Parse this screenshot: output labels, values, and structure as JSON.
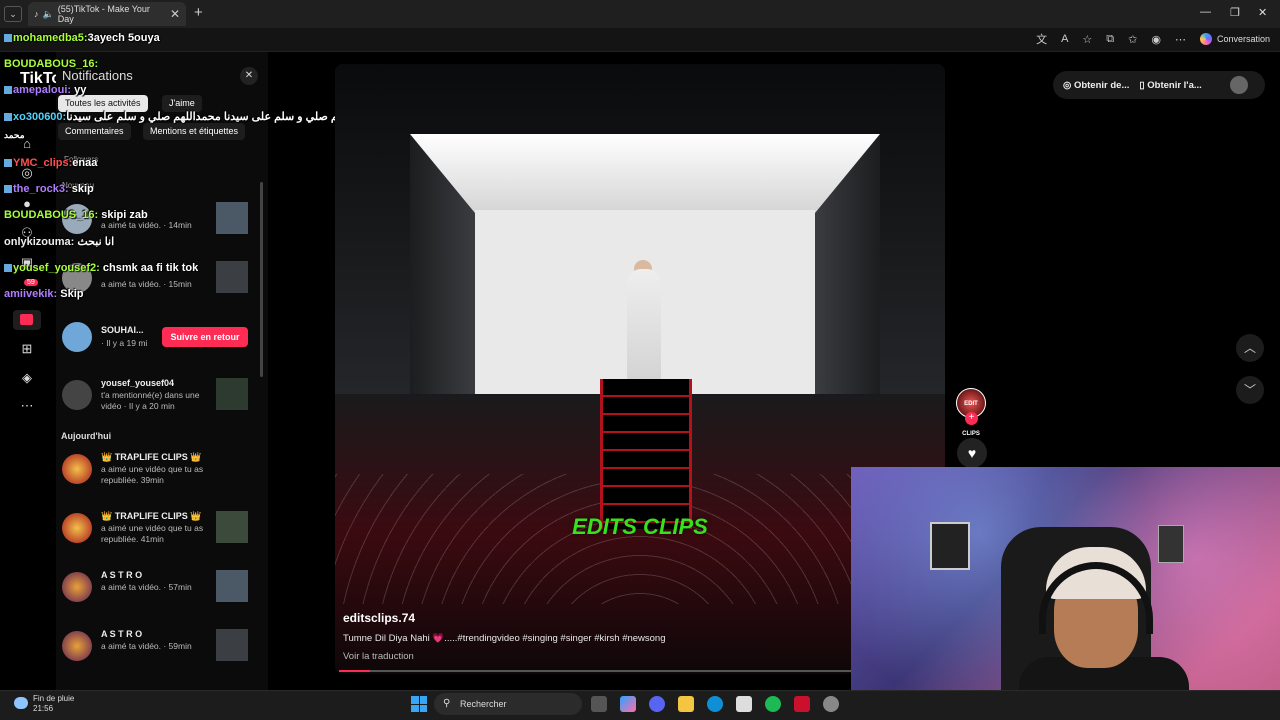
{
  "browser": {
    "tab_title": "(55)TikTok - Make Your Day",
    "copilot_label": "Conversation"
  },
  "tiktok": {
    "logo": "TikTok",
    "nav_badge": "59"
  },
  "notifications": {
    "title": "Notifications",
    "filters": [
      "Toutes les activités",
      "J'aime",
      "Commentaires",
      "Mentions et étiquettes"
    ],
    "section_followers": "Followers",
    "section_new": "Nouveau",
    "section_today": "Aujourd'hui",
    "items": [
      {
        "name": "",
        "text": "a aimé ta vidéo. · 14min"
      },
      {
        "name": "",
        "text": "a aimé ta vidéo. · 15min"
      },
      {
        "name": "SOUHAI...",
        "text": "· Il y a 19 mi"
      },
      {
        "name": "yousef_yousef04",
        "text": "t'a mentionné(e) dans une vidéo · Il y a 20 min"
      },
      {
        "name": "👑 TRAPLIFE CLIPS 👑",
        "text": "a aimé une vidéo que tu as republiée. 39min"
      },
      {
        "name": "👑 TRAPLIFE CLIPS 👑",
        "text": "a aimé une vidéo que tu as republiée. 41min"
      },
      {
        "name": "A S T R O",
        "text": "a aimé ta vidéo. · 57min"
      },
      {
        "name": "A S T R O",
        "text": "a aimé ta vidéo. · 59min"
      }
    ],
    "follow_back_label": "Suivre en retour"
  },
  "chat": [
    {
      "user": "mohamedba5:",
      "msg": "3ayech 5ouya"
    },
    {
      "user": "BOUDABOUS_16:",
      "msg": ""
    },
    {
      "user": "amepaloui:",
      "msg": "yy"
    },
    {
      "user": "",
      "msg": "اللهم صلي و سلم على سيدنا محمداللهم صلي و سلم على سيدنا"
    },
    {
      "user": "xo300600:",
      "msg": ""
    },
    {
      "user": "",
      "msg": "محمد"
    },
    {
      "user": "YMC_clips:",
      "msg": "enaa"
    },
    {
      "user": "the_rock3:",
      "msg": "skip"
    },
    {
      "user": "BOUDABOUS_16:",
      "msg": "skipi zab"
    },
    {
      "user": "onlykizouma:",
      "msg": "انا نبحث"
    },
    {
      "user": "yousef_yousef2:",
      "msg": "chsmk aa fi tik tok"
    },
    {
      "user": "amiivekik:",
      "msg": "Skip"
    }
  ],
  "video": {
    "overlay_title": "EDITS CLIPS",
    "author": "editsclips.74",
    "caption": "Tumne Dil Diya Nahi 💗.....#trendingvideo #singing #singer #kirsh #newsong",
    "translate": "Voir la traduction",
    "progress_percent": 6,
    "creator_avatar_text": "EDIT CLIPS"
  },
  "top_actions": [
    "Obtenir de...",
    "Obtenir l'a..."
  ],
  "taskbar": {
    "weather_line1": "Fin de pluie",
    "weather_line2": "21:56",
    "search_label": "Rechercher"
  }
}
